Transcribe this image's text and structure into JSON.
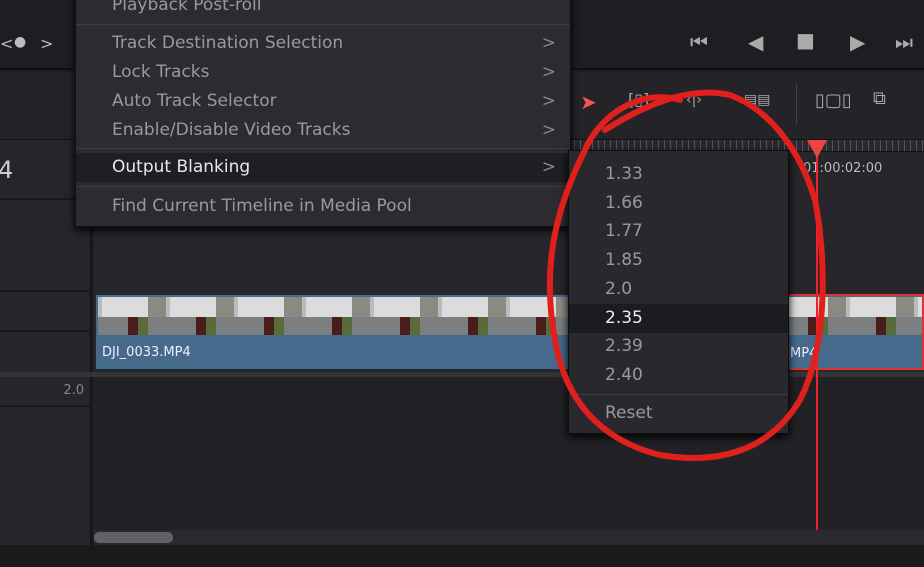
{
  "menu": {
    "items": [
      {
        "label": "Playback Post-roll"
      },
      {
        "label": "Track Destination Selection",
        "arrow": ">"
      },
      {
        "label": "Lock Tracks",
        "arrow": ">"
      },
      {
        "label": "Auto Track Selector",
        "arrow": ">"
      },
      {
        "label": "Enable/Disable Video Tracks",
        "arrow": ">"
      },
      {
        "label": "Output Blanking",
        "arrow": ">"
      },
      {
        "label": "Find Current Timeline in Media Pool"
      }
    ]
  },
  "submenu": {
    "items": [
      "1.33",
      "1.66",
      "1.77",
      "1.85",
      "2.0",
      "2.35",
      "2.39",
      "2.40",
      "Reset"
    ],
    "highlighted": "2.35"
  },
  "timeline": {
    "timecode": "01:00:02:00",
    "clip_name": "DJI_0033.MP4",
    "clip_name_tail": "MP4",
    "track_number": "4",
    "audio_label": "2.0"
  },
  "nav": {
    "left": "<",
    "dot": "●",
    "right": ">"
  },
  "transport": {
    "first": "⏮",
    "prev": "◀",
    "stop": "■",
    "play": "▶",
    "last": "⏭"
  },
  "colors": {
    "annotation": "#e0201c",
    "clip": "#456a8c",
    "playhead": "#e23333"
  }
}
